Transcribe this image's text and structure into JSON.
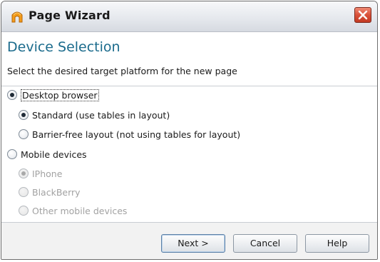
{
  "window": {
    "title": "Page Wizard",
    "close_icon": "close-icon"
  },
  "header": {
    "title": "Device Selection",
    "description": "Select the desired target platform for the new page"
  },
  "options": {
    "desktop": {
      "label": "Desktop browser",
      "checked": true,
      "enabled": true
    },
    "standard": {
      "label": "Standard (use tables in layout)",
      "checked": true,
      "enabled": true
    },
    "barrier_free": {
      "label": "Barrier-free layout (not using tables for layout)",
      "checked": false,
      "enabled": true
    },
    "mobile": {
      "label": "Mobile devices",
      "checked": false,
      "enabled": true
    },
    "iphone": {
      "label": "IPhone",
      "checked": true,
      "enabled": false
    },
    "blackberry": {
      "label": "BlackBerry",
      "checked": false,
      "enabled": false
    },
    "other_mobile": {
      "label": "Other mobile devices",
      "checked": false,
      "enabled": false
    }
  },
  "buttons": {
    "next": "Next >",
    "cancel": "Cancel",
    "help": "Help"
  },
  "colors": {
    "header_title": "#1b6b8c",
    "close_button": "#d9513a",
    "disabled_text": "#a2a2a2"
  }
}
